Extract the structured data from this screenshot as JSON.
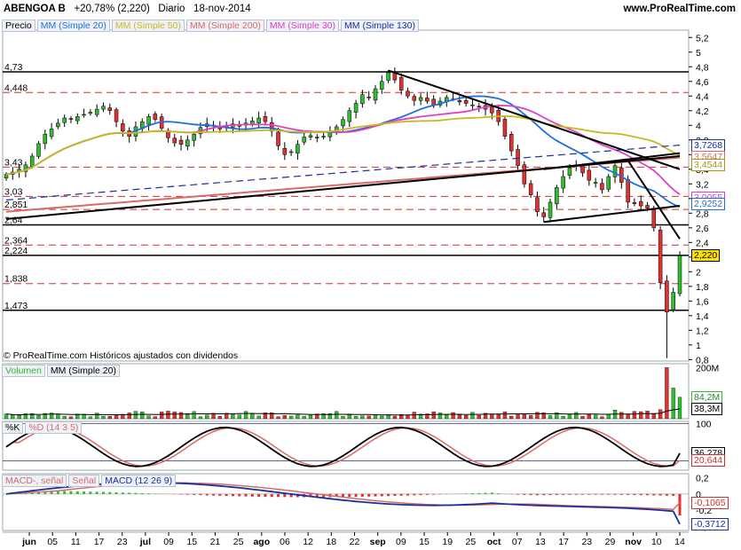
{
  "header": {
    "ticker": "ABENGOA B",
    "change": "+20,78% (2,220)",
    "period": "Diario",
    "date": "18-nov-2014",
    "site": "www.ProRealTime.com"
  },
  "copyright": "© ProRealTime.com Históricos ajustados con dividendos",
  "price_legend": [
    "Precio",
    "MM (Simple 20)",
    "MM (Simple 50)",
    "MM (Simple 200)",
    "MM (Simple 30)",
    "MM (Simple 130)"
  ],
  "volume_legend": [
    "Volumen",
    "MM (Simple 20)"
  ],
  "stoch_legend": [
    "%K",
    "%D (14 3 5)"
  ],
  "macd_legend": [
    "MACD-, señal",
    "Señal",
    "MACD (12 26 9)"
  ],
  "colors": {
    "up": "#2ebd2e",
    "down": "#e03030",
    "mm20": "#1f6fe0",
    "mm50": "#c9b820",
    "mm200": "#d86a6a",
    "mm30": "#e040c8",
    "mm130": "#1a2fa0"
  },
  "chart_data": [
    {
      "type": "candlestick",
      "panel": "price",
      "x_ticks": [
        "jun",
        "05",
        "11",
        "17",
        "23",
        "jul",
        "09",
        "15",
        "21",
        "25",
        "ago",
        "06",
        "12",
        "18",
        "22",
        "sep",
        "09",
        "15",
        "19",
        "25",
        "oct",
        "07",
        "13",
        "17",
        "23",
        "29",
        "nov",
        "10",
        "14"
      ],
      "y_ticks": [
        "5,2",
        "5",
        "4,8",
        "4,6",
        "4,4",
        "4,2",
        "4",
        "3,8",
        "3,6",
        "3,4",
        "3,2",
        "3",
        "2,8",
        "2,6",
        "2,4",
        "2,2",
        "2",
        "1,8",
        "1,6",
        "1,4",
        "1,2",
        "1",
        "0,8"
      ],
      "ylim": [
        0.78,
        5.3
      ],
      "horizontal_levels": [
        "4,73",
        "4,448",
        "3,43",
        "3,03",
        "2,851",
        "2,64",
        "2,364",
        "2,224",
        "1,838",
        "1,473"
      ],
      "last_price": "2,220",
      "ma_values": {
        "mm130": "3,7268",
        "mm200": "3,5647",
        "mm50": "3,4544",
        "mm30": "3,0055",
        "mm20": "2,9252"
      },
      "closes": [
        3.33,
        3.36,
        3.4,
        3.46,
        3.58,
        3.75,
        3.88,
        3.95,
        4.03,
        4.1,
        4.08,
        4.12,
        4.15,
        4.18,
        4.22,
        4.26,
        4.2,
        4.05,
        3.92,
        3.85,
        3.98,
        4.05,
        4.12,
        4.08,
        3.96,
        3.83,
        3.76,
        3.74,
        3.8,
        3.88,
        3.97,
        4.02,
        4.0,
        3.95,
        3.98,
        4.02,
        4.0,
        4.03,
        4.06,
        4.1,
        4.05,
        3.92,
        3.72,
        3.6,
        3.64,
        3.74,
        3.84,
        3.86,
        3.83,
        3.85,
        3.9,
        3.98,
        4.08,
        4.2,
        4.3,
        4.42,
        4.38,
        4.5,
        4.6,
        4.72,
        4.62,
        4.48,
        4.4,
        4.34,
        4.38,
        4.33,
        4.28,
        4.33,
        4.38,
        4.36,
        4.32,
        4.3,
        4.28,
        4.25,
        4.22,
        4.17,
        4.05,
        3.85,
        3.65,
        3.45,
        3.2,
        3.05,
        2.82,
        2.75,
        2.95,
        3.15,
        3.3,
        3.42,
        3.46,
        3.35,
        3.25,
        3.22,
        3.12,
        3.3,
        3.45,
        3.22,
        2.95,
        2.93,
        2.9,
        2.87,
        2.6,
        1.85,
        1.45,
        1.72,
        2.22
      ],
      "volume": {
        "y_ticks": [
          "200M",
          "84,2M",
          "38,3M"
        ],
        "last": "84,2M",
        "mm20": "38,3M"
      },
      "stochastic": {
        "y_ticks": [
          "100",
          "36,278",
          "20,644"
        ],
        "k": "36,278",
        "d": "20,644"
      },
      "macd": {
        "y_ticks": [
          "0,2",
          "0",
          "-0,2",
          "-0,4"
        ],
        "macd": "-0,3712",
        "signal": "-0,1065"
      }
    }
  ]
}
